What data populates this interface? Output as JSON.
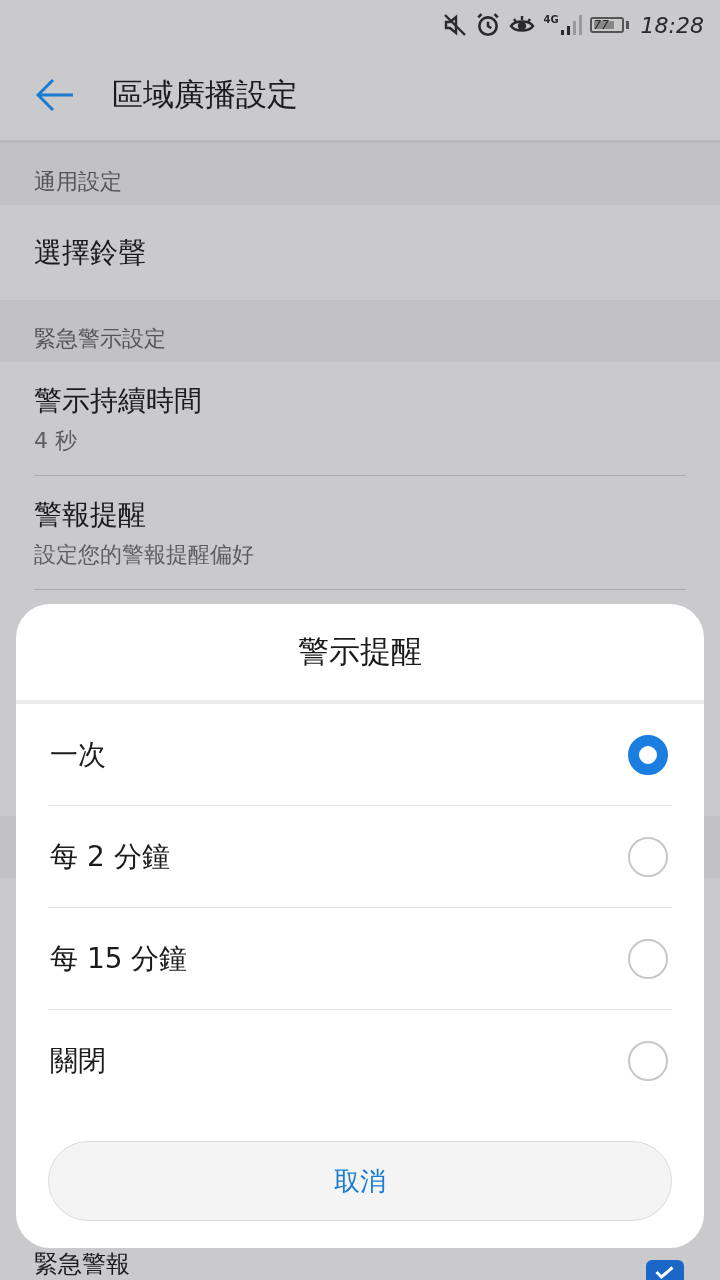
{
  "status_bar": {
    "network": "4G",
    "battery": "77",
    "time": "18:28"
  },
  "header": {
    "title": "區域廣播設定"
  },
  "sections": [
    {
      "title": "通用設定",
      "items": [
        {
          "title": "選擇鈴聲"
        }
      ]
    },
    {
      "title": "緊急警示設定",
      "items": [
        {
          "title": "警示持續時間",
          "subtitle": "4 秒"
        },
        {
          "title": "警報提醒",
          "subtitle": "設定您的警報提醒偏好"
        }
      ]
    }
  ],
  "peek_item": {
    "title": "緊急警報",
    "checked": true
  },
  "dialog": {
    "title": "警示提醒",
    "options": [
      {
        "label": "一次",
        "selected": true
      },
      {
        "label": "每 2 分鐘",
        "selected": false
      },
      {
        "label": "每 15 分鐘",
        "selected": false
      },
      {
        "label": "關閉",
        "selected": false
      }
    ],
    "cancel": "取消"
  }
}
